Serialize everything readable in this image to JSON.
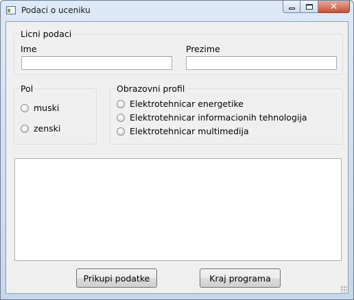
{
  "window": {
    "title": "Podaci o uceniku",
    "icons": {
      "app": "window-app-icon",
      "minimize": "minimize-icon",
      "maximize": "maximize-icon",
      "close": "close-icon"
    },
    "close_glyph": "✕"
  },
  "personal": {
    "legend": "Licni podaci",
    "first_name_label": "Ime",
    "first_name_value": "",
    "last_name_label": "Prezime",
    "last_name_value": ""
  },
  "gender": {
    "legend": "Pol",
    "options": [
      "muski",
      "zenski"
    ],
    "selected": null
  },
  "profile": {
    "legend": "Obrazovni profil",
    "options": [
      "Elektrotehnicar energetike",
      "Elektrotehnicar informacionih tehnologija",
      "Elektrotehnicar multimedija"
    ],
    "selected": null
  },
  "output": {
    "text": ""
  },
  "buttons": {
    "collect": "Prikupi podatke",
    "exit": "Kraj programa"
  }
}
